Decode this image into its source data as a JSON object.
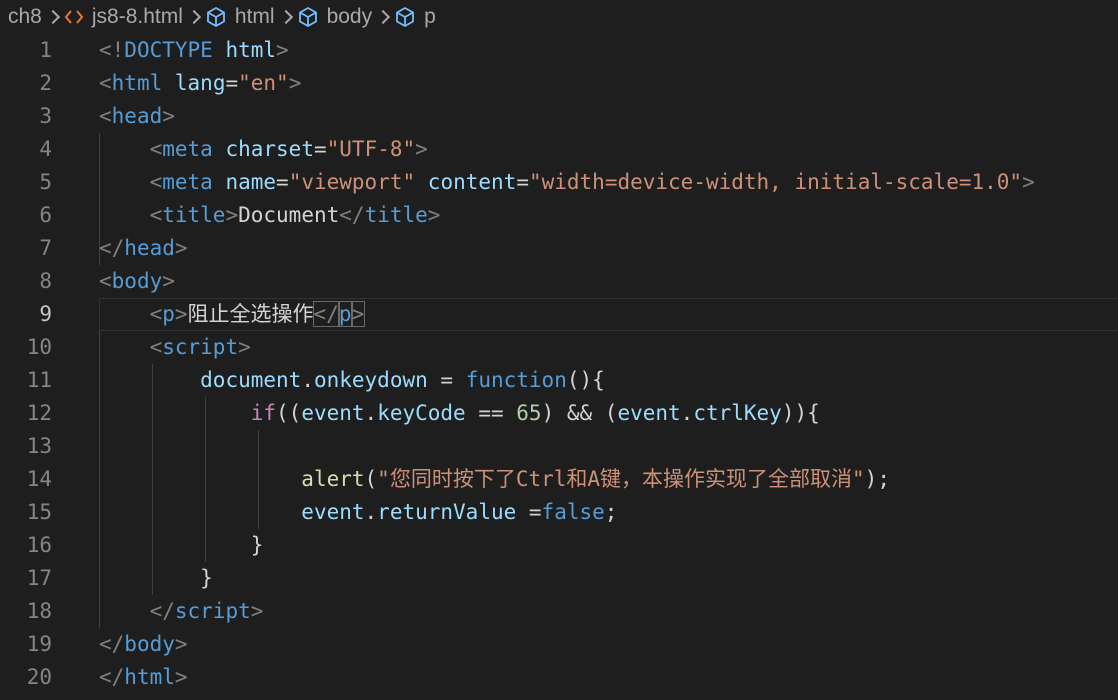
{
  "breadcrumb": {
    "folder": "ch8",
    "file": "js8-8.html",
    "crumbs": [
      "html",
      "body",
      "p"
    ]
  },
  "editor": {
    "active_line": 9,
    "line_numbers": [
      "1",
      "2",
      "3",
      "4",
      "5",
      "6",
      "7",
      "8",
      "9",
      "10",
      "11",
      "12",
      "13",
      "14",
      "15",
      "16",
      "17",
      "18",
      "19",
      "20"
    ],
    "lines": [
      [
        [
          "pun",
          "<!"
        ],
        [
          "tag",
          "DOCTYPE"
        ],
        [
          "txt",
          " "
        ],
        [
          "attr",
          "html"
        ],
        [
          "pun",
          ">"
        ]
      ],
      [
        [
          "pun",
          "<"
        ],
        [
          "tag",
          "html"
        ],
        [
          "txt",
          " "
        ],
        [
          "attr",
          "lang"
        ],
        [
          "txt",
          "="
        ],
        [
          "str",
          "\"en\""
        ],
        [
          "pun",
          ">"
        ]
      ],
      [
        [
          "pun",
          "<"
        ],
        [
          "tag",
          "head"
        ],
        [
          "pun",
          ">"
        ]
      ],
      [
        [
          "txt",
          "    "
        ],
        [
          "pun",
          "<"
        ],
        [
          "tag",
          "meta"
        ],
        [
          "txt",
          " "
        ],
        [
          "attr",
          "charset"
        ],
        [
          "txt",
          "="
        ],
        [
          "str",
          "\"UTF-8\""
        ],
        [
          "pun",
          ">"
        ]
      ],
      [
        [
          "txt",
          "    "
        ],
        [
          "pun",
          "<"
        ],
        [
          "tag",
          "meta"
        ],
        [
          "txt",
          " "
        ],
        [
          "attr",
          "name"
        ],
        [
          "txt",
          "="
        ],
        [
          "str",
          "\"viewport\""
        ],
        [
          "txt",
          " "
        ],
        [
          "attr",
          "content"
        ],
        [
          "txt",
          "="
        ],
        [
          "str",
          "\"width=device-width, initial-scale=1.0\""
        ],
        [
          "pun",
          ">"
        ]
      ],
      [
        [
          "txt",
          "    "
        ],
        [
          "pun",
          "<"
        ],
        [
          "tag",
          "title"
        ],
        [
          "pun",
          ">"
        ],
        [
          "txt",
          "Document"
        ],
        [
          "pun",
          "</"
        ],
        [
          "tag",
          "title"
        ],
        [
          "pun",
          ">"
        ]
      ],
      [
        [
          "pun",
          "</"
        ],
        [
          "tag",
          "head"
        ],
        [
          "pun",
          ">"
        ]
      ],
      [
        [
          "pun",
          "<"
        ],
        [
          "tag",
          "body"
        ],
        [
          "pun",
          ">"
        ]
      ],
      [
        [
          "txt",
          "    "
        ],
        [
          "pun",
          "<"
        ],
        [
          "tag",
          "p"
        ],
        [
          "pun",
          ">"
        ],
        [
          "cjk",
          "阻止全选操作"
        ],
        [
          "pun",
          "</"
        ],
        [
          "tag",
          "p"
        ],
        [
          "pun",
          ">"
        ]
      ],
      [
        [
          "txt",
          "    "
        ],
        [
          "pun",
          "<"
        ],
        [
          "tag",
          "script"
        ],
        [
          "pun",
          ">"
        ]
      ],
      [
        [
          "txt",
          "        "
        ],
        [
          "var",
          "document"
        ],
        [
          "op",
          "."
        ],
        [
          "var",
          "onkeydown"
        ],
        [
          "op",
          " = "
        ],
        [
          "kw",
          "function"
        ],
        [
          "op",
          "(){"
        ]
      ],
      [
        [
          "txt",
          "            "
        ],
        [
          "ctl",
          "if"
        ],
        [
          "op",
          "(("
        ],
        [
          "var",
          "event"
        ],
        [
          "op",
          "."
        ],
        [
          "var",
          "keyCode"
        ],
        [
          "op",
          " == "
        ],
        [
          "num",
          "65"
        ],
        [
          "op",
          ") && ("
        ],
        [
          "var",
          "event"
        ],
        [
          "op",
          "."
        ],
        [
          "var",
          "ctrlKey"
        ],
        [
          "op",
          "))"
        ],
        [
          "op",
          "{"
        ]
      ],
      [],
      [
        [
          "txt",
          "                "
        ],
        [
          "fn",
          "alert"
        ],
        [
          "op",
          "("
        ],
        [
          "str",
          "\"您同时按下了Ctrl和A键，本操作实现了全部取消\""
        ],
        [
          "op",
          ");"
        ]
      ],
      [
        [
          "txt",
          "                "
        ],
        [
          "var",
          "event"
        ],
        [
          "op",
          "."
        ],
        [
          "var",
          "returnValue"
        ],
        [
          "op",
          " ="
        ],
        [
          "kw",
          "false"
        ],
        [
          "op",
          ";"
        ]
      ],
      [
        [
          "txt",
          "            "
        ],
        [
          "op",
          "}"
        ]
      ],
      [
        [
          "txt",
          "        "
        ],
        [
          "op",
          "}"
        ]
      ],
      [
        [
          "txt",
          "    "
        ],
        [
          "pun",
          "</"
        ],
        [
          "tag",
          "script"
        ],
        [
          "pun",
          ">"
        ]
      ],
      [
        [
          "pun",
          "</"
        ],
        [
          "tag",
          "body"
        ],
        [
          "pun",
          ">"
        ]
      ],
      [
        [
          "pun",
          "</"
        ],
        [
          "tag",
          "html"
        ],
        [
          "pun",
          ">"
        ]
      ]
    ]
  }
}
